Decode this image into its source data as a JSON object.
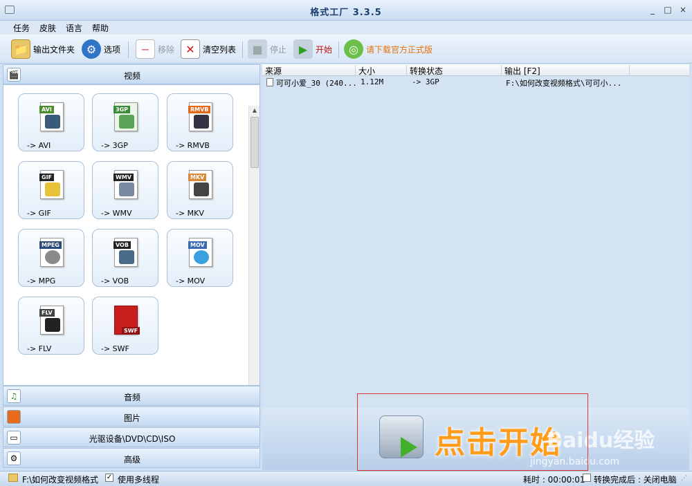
{
  "window": {
    "title": "格式工厂  3.3.5",
    "min": "_",
    "max": "□",
    "close": "×"
  },
  "menu": [
    "任务",
    "皮肤",
    "语言",
    "帮助"
  ],
  "toolbar": {
    "output_folder": "输出文件夹",
    "options": "选项",
    "remove": "移除",
    "clear_list": "清空列表",
    "stop": "停止",
    "start": "开始",
    "download": "请下载官方正式版"
  },
  "categories": {
    "video": "视频",
    "audio": "音频",
    "image": "图片",
    "disc": "光驱设备\\DVD\\CD\\ISO",
    "advanced": "高级"
  },
  "formats": [
    {
      "tag": "AVI",
      "label": "-> AVI",
      "color": "#4a8c2a"
    },
    {
      "tag": "3GP",
      "label": "-> 3GP",
      "color": "#3c8a3c"
    },
    {
      "tag": "RMVB",
      "label": "-> RMVB",
      "color": "#e06a1a"
    },
    {
      "tag": "GIF",
      "label": "-> GIF",
      "color": "#222222"
    },
    {
      "tag": "WMV",
      "label": "-> WMV",
      "color": "#222222"
    },
    {
      "tag": "MKV",
      "label": "-> MKV",
      "color": "#d88a3a"
    },
    {
      "tag": "MPEG",
      "label": "-> MPG",
      "color": "#2a4a7a"
    },
    {
      "tag": "VOB",
      "label": "-> VOB",
      "color": "#222222"
    },
    {
      "tag": "MOV",
      "label": "-> MOV",
      "color": "#3a6ab0"
    },
    {
      "tag": "FLV",
      "label": "-> FLV",
      "color": "#444444"
    },
    {
      "tag": "SWF",
      "label": "-> SWF",
      "color": "#c81e1e"
    }
  ],
  "list": {
    "headers": [
      "来源",
      "大小",
      "转换状态",
      "输出 [F2]"
    ],
    "rows": [
      {
        "source": "可可小爱_30 (240...",
        "size": "1.12M",
        "status": "-> 3GP",
        "output": "F:\\如何改变视频格式\\可可小..."
      }
    ]
  },
  "start_overlay": {
    "text": "点击开始",
    "watermark": "Baidu经验",
    "watermark_url": "jingyan.baidu.com"
  },
  "status": {
    "output_path": "F:\\如何改变视频格式",
    "multithread_checked": "✓",
    "multithread_label": "使用多线程",
    "elapsed": "耗时 : 00:00:01",
    "after_label": "转换完成后 : 关闭电脑"
  }
}
